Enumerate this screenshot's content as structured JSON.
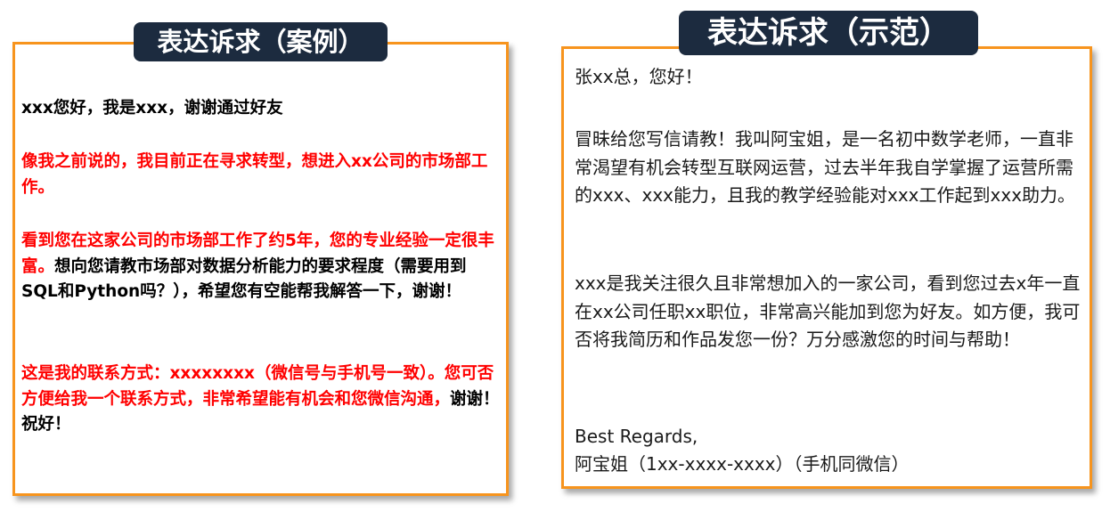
{
  "case_panel": {
    "title": "表达诉求（案例）",
    "greeting": "xxx您好，我是xxx，谢谢通过好友",
    "p1": "像我之前说的，我目前正在寻求转型，想进入xx公司的市场部工作。",
    "p2_red": "看到您在这家公司的市场部工作了约5年，您的专业经验一定很丰富。",
    "p2_black": "想向您请教市场部对数据分析能力的要求程度（需要用到SQL和Python吗？），希望您有空能帮我解答一下，谢谢！",
    "p3_red": "这是我的联系方式：xxxxxxxx（微信号与手机号一致）。您可否方便给我一个联系方式，非常希望能有机会和您微信沟通，",
    "p3_black": "谢谢！祝好！"
  },
  "demo_panel": {
    "title": "表达诉求（示范）",
    "greeting": "张xx总，您好！",
    "p1": "冒昧给您写信请教！我叫阿宝姐，是一名初中数学老师，一直非常渴望有机会转型互联网运营，过去半年我自学掌握了运营所需的xxx、xxx能力，且我的教学经验能对xxx工作起到xxx助力。",
    "p2": "xxx是我关注很久且非常想加入的一家公司，看到您过去x年一直在xx公司任职xx职位，非常高兴能加到您为好友。如方便，我可否将我简历和作品发您一份？万分感激您的时间与帮助！",
    "sign_line1": "Best Regards,",
    "sign_line2": "阿宝姐（1xx-xxxx-xxxx）（手机同微信）"
  },
  "colors": {
    "border": "#f7941d",
    "title_bg": "#1c2b3f",
    "highlight": "#ff0000"
  }
}
